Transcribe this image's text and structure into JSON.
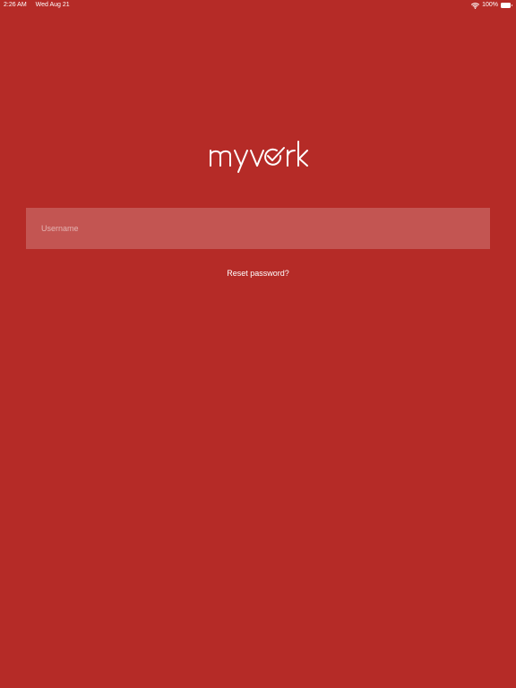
{
  "status_bar": {
    "time": "2:26 AM",
    "date": "Wed Aug 21",
    "battery": "100%",
    "wifi_icon": "wifi-icon",
    "battery_icon": "battery-icon"
  },
  "logo": {
    "text": "myvork"
  },
  "login": {
    "username_placeholder": "Username",
    "username_value": ""
  },
  "reset_link": "Reset password?",
  "colors": {
    "background": "#B52B27",
    "field_background": "rgba(255,255,255,0.2)",
    "text": "#FFFFFF"
  }
}
